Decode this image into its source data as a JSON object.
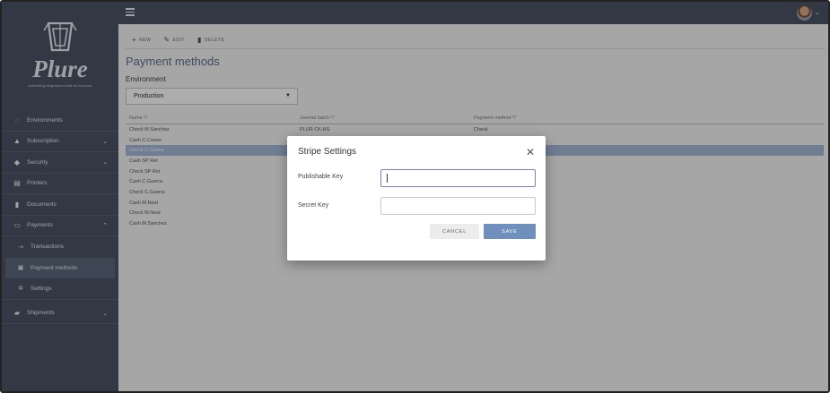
{
  "brand": {
    "name": "Plure",
    "tagline": "Automating integrations made for everyone"
  },
  "sidebar": {
    "items": [
      {
        "label": "Environments",
        "icon": "circle-sync-icon",
        "chevron": ""
      },
      {
        "label": "Subscription",
        "icon": "bell-icon",
        "chevron": "⌄"
      },
      {
        "label": "Security",
        "icon": "shield-icon",
        "chevron": "⌄"
      },
      {
        "label": "Printers",
        "icon": "printer-icon",
        "chevron": ""
      },
      {
        "label": "Documents",
        "icon": "document-icon",
        "chevron": ""
      },
      {
        "label": "Payments",
        "icon": "card-icon",
        "chevron": "⌃"
      }
    ],
    "payments_sub": [
      {
        "label": "Transactions",
        "icon": "arrow-icon"
      },
      {
        "label": "Payment methods",
        "icon": "payment-methods-icon"
      },
      {
        "label": "Settings",
        "icon": "gear-icon"
      }
    ],
    "shipments": {
      "label": "Shipments",
      "icon": "truck-icon",
      "chevron": "⌄"
    }
  },
  "toolbar": {
    "new_label": "NEW",
    "edit_label": "EDIT",
    "delete_label": "DELETE"
  },
  "page": {
    "title": "Payment methods",
    "environment_label": "Environment",
    "environment_value": "Production"
  },
  "table": {
    "headers": [
      "Name",
      "Journal batch",
      "Payment method"
    ],
    "rows": [
      [
        "Check M.Sanchez",
        "PLUR CK-HS",
        "Check"
      ],
      [
        "Cash C.Cones",
        "",
        ""
      ],
      [
        "Check C.Cones",
        "",
        ""
      ],
      [
        "Cash SP Ret",
        "",
        ""
      ],
      [
        "Check SP Ret",
        "",
        ""
      ],
      [
        "Cash C.Guerra",
        "",
        ""
      ],
      [
        "Check C.Guerra",
        "",
        ""
      ],
      [
        "Cash M.Neal",
        "",
        ""
      ],
      [
        "Check M.Neal",
        "",
        ""
      ],
      [
        "Cash M.Sanchez",
        "",
        ""
      ]
    ],
    "selected_row_index": 2
  },
  "dialog": {
    "title": "Stripe Settings",
    "publishable_key_label": "Publishable Key",
    "publishable_key_value": "",
    "secret_key_label": "Secret Key",
    "secret_key_value": "",
    "cancel_label": "CANCEL",
    "save_label": "SAVE"
  },
  "colors": {
    "sidebar_bg": "#4a5566",
    "accent_title": "#5d6f8b",
    "save_button": "#6f8fbd",
    "focus_border": "#7b7fc8",
    "selected_row": "#a7b8d9"
  }
}
